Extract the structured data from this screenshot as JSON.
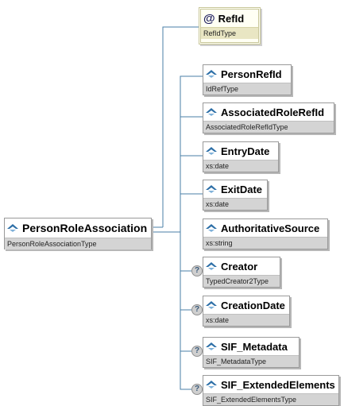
{
  "root": {
    "name": "PersonRoleAssociation",
    "type": "PersonRoleAssociationType"
  },
  "attribute": {
    "name": "RefId",
    "type": "RefIdType"
  },
  "elements": [
    {
      "name": "PersonRefId",
      "type": "IdRefType",
      "optional": false
    },
    {
      "name": "AssociatedRoleRefId",
      "type": "AssociatedRoleRefIdType",
      "optional": false
    },
    {
      "name": "EntryDate",
      "type": "xs:date",
      "optional": false
    },
    {
      "name": "ExitDate",
      "type": "xs:date",
      "optional": false
    },
    {
      "name": "AuthoritativeSource",
      "type": "xs:string",
      "optional": false
    },
    {
      "name": "Creator",
      "type": "TypedCreator2Type",
      "optional": true
    },
    {
      "name": "CreationDate",
      "type": "xs:date",
      "optional": true
    },
    {
      "name": "SIF_Metadata",
      "type": "SIF_MetadataType",
      "optional": true
    },
    {
      "name": "SIF_ExtendedElements",
      "type": "SIF_ExtendedElementsType",
      "optional": true
    }
  ],
  "icons": {
    "attribute": "at-sign-icon",
    "element": "element-icon",
    "optional": "question-icon"
  },
  "optional_symbol": "?",
  "attribute_symbol": "@",
  "colors": {
    "connector": "#4a7fa7",
    "attribute_border": "#c8c69a",
    "type_band": "#d4d4d4"
  }
}
